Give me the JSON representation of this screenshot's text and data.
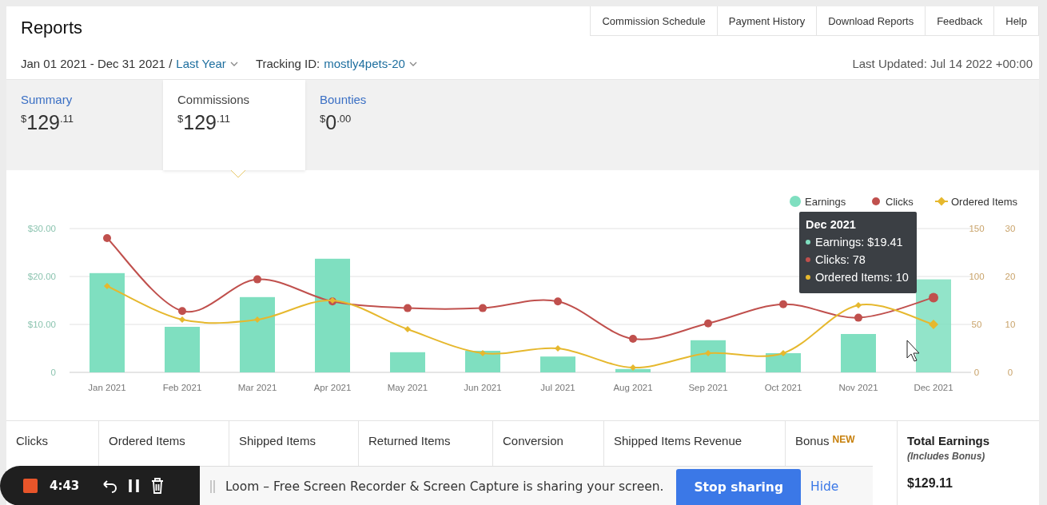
{
  "header": {
    "title": "Reports",
    "nav": [
      "Commission Schedule",
      "Payment History",
      "Download Reports",
      "Feedback",
      "Help"
    ],
    "date_range": "Jan 01 2021 - Dec 31 2021 /",
    "period": "Last Year",
    "tracking_label": "Tracking ID:",
    "tracking_id": "mostly4pets-20",
    "last_updated": "Last Updated: Jul 14 2022 +00:00"
  },
  "tabs": [
    {
      "label": "Summary",
      "currency": "$",
      "whole": "129",
      "fraction": ".11",
      "selected": false
    },
    {
      "label": "Commissions",
      "currency": "$",
      "whole": "129",
      "fraction": ".11",
      "selected": true
    },
    {
      "label": "Bounties",
      "currency": "$",
      "whole": "0",
      "fraction": ".00",
      "selected": false
    }
  ],
  "chart": {
    "chart_data": {
      "type": "bar",
      "categories": [
        "Jan 2021",
        "Feb 2021",
        "Mar 2021",
        "Apr 2021",
        "May 2021",
        "Jun 2021",
        "Jul 2021",
        "Aug 2021",
        "Sep 2021",
        "Oct 2021",
        "Nov 2021",
        "Dec 2021"
      ],
      "ylim": [
        0,
        30
      ],
      "yticks": [
        {
          "value": 0,
          "label": "0"
        },
        {
          "value": 10,
          "label": "$10.00"
        },
        {
          "value": 20,
          "label": "$20.00"
        },
        {
          "value": 30,
          "label": "$30.00"
        }
      ],
      "series": [
        {
          "name": "Earnings",
          "type": "bar",
          "color": "#7fdfc0",
          "values": [
            20.7,
            9.5,
            15.7,
            23.7,
            4.2,
            4.5,
            3.3,
            0.7,
            6.7,
            4.0,
            8.0,
            19.4
          ]
        },
        {
          "name": "Clicks",
          "type": "line",
          "color": "#c0504d",
          "axis": "y2",
          "marker": "circle",
          "values": [
            140,
            64,
            97,
            74,
            67,
            67,
            74,
            35,
            51,
            71,
            57,
            78
          ]
        },
        {
          "name": "Ordered Items",
          "type": "line",
          "color": "#e6b82e",
          "axis": "y3",
          "marker": "diamond",
          "values": [
            18,
            11,
            11,
            15,
            9,
            4,
            5,
            1,
            4,
            4,
            14,
            10
          ]
        }
      ],
      "legend": true,
      "y2lim": [
        0,
        150
      ],
      "y2ticks": [
        0,
        50,
        100,
        150
      ],
      "y3lim": [
        0,
        30
      ],
      "y3ticks": [
        0,
        10,
        20,
        30
      ]
    },
    "tooltip": {
      "title": "Dec 2021",
      "lines": [
        {
          "text": "Earnings: $19.41",
          "color": "#7fdfc0"
        },
        {
          "text": "Clicks: 78",
          "color": "#c0504d"
        },
        {
          "text": "Ordered Items: 10",
          "color": "#e6b82e"
        }
      ]
    }
  },
  "table": {
    "columns": [
      {
        "label": "Clicks"
      },
      {
        "label": "Ordered Items"
      },
      {
        "label": "Shipped Items"
      },
      {
        "label": "Returned Items"
      },
      {
        "label": "Conversion"
      },
      {
        "label": "Shipped Items Revenue"
      },
      {
        "label": "Bonus",
        "badge": "NEW"
      }
    ],
    "total": {
      "label": "Total Earnings",
      "note": "(Includes Bonus)",
      "value": "$129.11"
    }
  },
  "recorder": {
    "time": "4:43",
    "message": "Loom – Free Screen Recorder & Screen Capture is sharing your screen.",
    "stop_button": "Stop sharing",
    "hide_link": "Hide"
  }
}
